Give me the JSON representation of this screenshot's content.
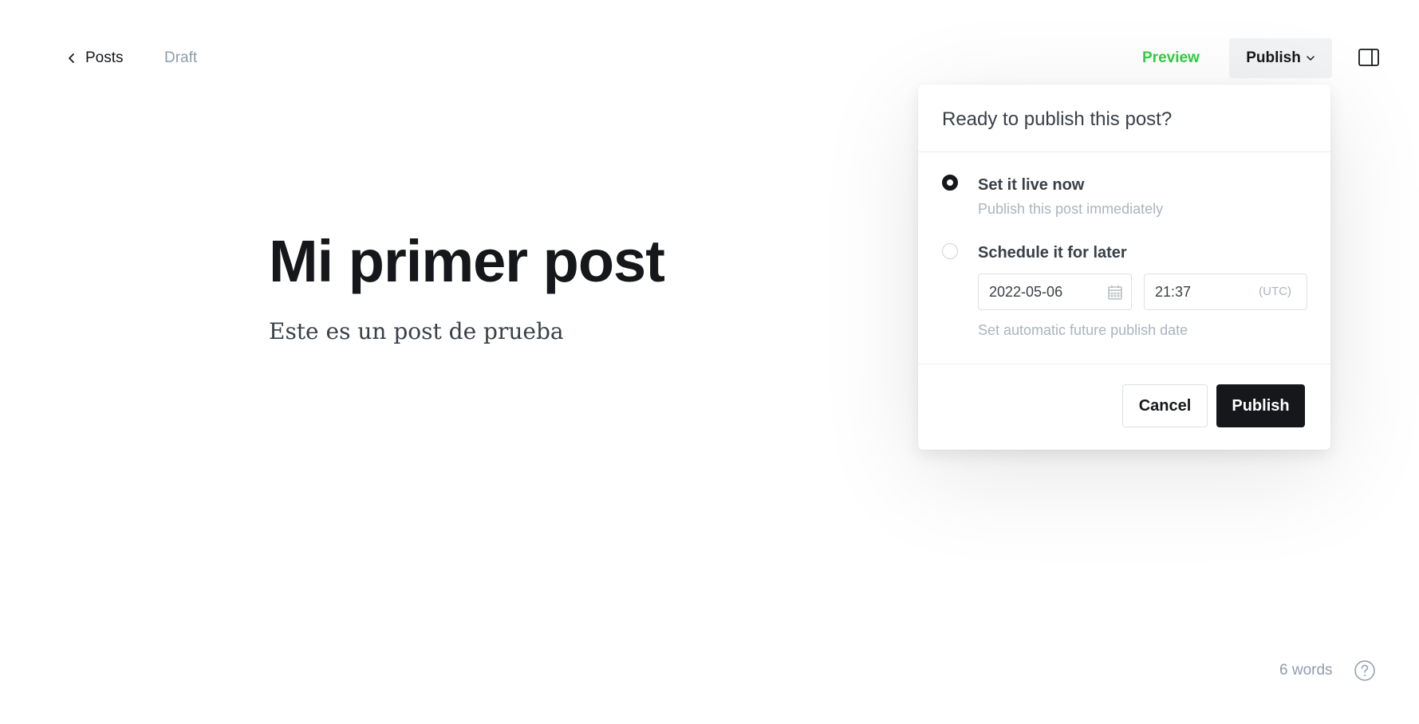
{
  "header": {
    "back_label": "Posts",
    "status": "Draft",
    "preview_label": "Preview",
    "publish_label": "Publish"
  },
  "editor": {
    "title": "Mi primer post",
    "body": "Este es un post de prueba"
  },
  "publish_menu": {
    "title": "Ready to publish this post?",
    "options": [
      {
        "label": "Set it live now",
        "description": "Publish this post immediately",
        "selected": true
      },
      {
        "label": "Schedule it for later",
        "description": "Set automatic future publish date",
        "selected": false
      }
    ],
    "date_value": "2022-05-06",
    "time_value": "21:37",
    "timezone": "(UTC)",
    "cancel_label": "Cancel",
    "publish_label": "Publish"
  },
  "footer": {
    "word_count": "6 words"
  },
  "colors": {
    "accent_green": "#30cf43",
    "primary_dark": "#15171a",
    "muted": "#8e9cac"
  },
  "icons": [
    "chevron-left-icon",
    "chevron-down-icon",
    "sidebar-toggle-icon",
    "calendar-icon",
    "help-icon"
  ]
}
